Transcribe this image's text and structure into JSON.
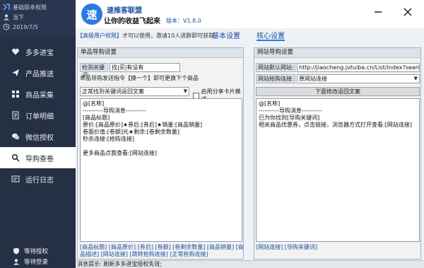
{
  "sidebar": {
    "user": {
      "edition": "基础版本权限",
      "name": "当下",
      "expiry": "2019/7/5"
    },
    "items": [
      {
        "label": "多多进宝",
        "icon": "heart-icon"
      },
      {
        "label": "产品推送",
        "icon": "send-icon"
      },
      {
        "label": "商品采集",
        "icon": "grid-icon"
      },
      {
        "label": "订单明细",
        "icon": "document-icon"
      },
      {
        "label": "微信授权",
        "icon": "wechat-icon"
      },
      {
        "label": "导购查卷",
        "icon": "search-icon"
      },
      {
        "label": "运行日志",
        "icon": "log-icon"
      }
    ],
    "active_index": 5,
    "footer": {
      "auth": "等待授权",
      "login": "等待登录"
    }
  },
  "header": {
    "title": "速推客联盟",
    "slogan": "让你的收益飞起来",
    "version": "版本：V1.8.0",
    "logo_char": "速"
  },
  "promo": {
    "prefix": "【高级用户权限】",
    "text": "才可以使用，邀请10人进群即可获取"
  },
  "tabs": [
    {
      "label": "基本设置"
    },
    {
      "label": "核心设置"
    }
  ],
  "left_panel": {
    "title": "单品导购设置",
    "keyword_label": "检测关键词:",
    "keyword_value": "找|买|有没有",
    "instruction": "单品导购发送指令【换一个】即可更换下个商品",
    "mode_select": "正常找到关键词返回文案",
    "checkbox_label": "启用分享卡片模式",
    "template": "@[名称]\n----------导购消息----------\n[商品标题]\n原价:[商品原价]★券后:[券后]★销量:[商品销量]\n卷面价值:[卷额]元★剩余:[卷剩余数量]\n秒杀连接:[抢购连接]\n\n更多商品点我查看:[网站连接]",
    "variables": "[商品标题] [商品原价] [券后] [卷额] [卷剩余数量] [商品销量] [商品描述] [网站连接] [跳转抢购连接] [正常抢购连接]"
  },
  "right_panel": {
    "title": "网站导购设置",
    "url_label": "网站默认网站:",
    "url_value": "http://jiaocheng.jvtuiba.cn/List/index?search=",
    "link_label": "网站抢购连接:",
    "link_select": "原网站连接",
    "button": "下面修改返回文案",
    "template": "@[名称]\n----------导购消息----------\n已为你找到[导购关键词]\n相关商品优惠券，点击链接，浏览器方式打开查看:[网站连接]",
    "variables": "[网站连接] [导购关键词]"
  },
  "status": {
    "text": "消息提示:   刷新多多进宝授权失效;"
  },
  "colors": {
    "sidebar_bg": "#253045",
    "accent": "#2a7ae2",
    "link": "#1a4fa0"
  }
}
